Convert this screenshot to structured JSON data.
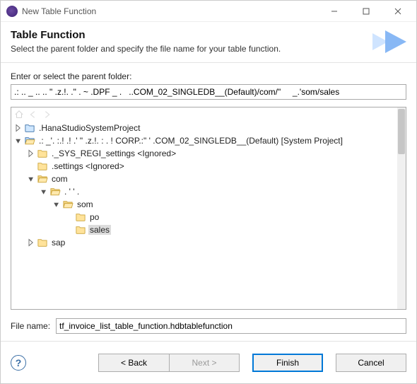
{
  "window": {
    "title": "New Table Function"
  },
  "banner": {
    "heading": "Table Function",
    "subheading": "Select the parent folder and specify the file name for your table function."
  },
  "parent_folder": {
    "label": "Enter or select the parent folder:",
    "value": ".: .. _ .. .. \" .z.!. .\" . ~ .DPF _ .   ..COM_02_SINGLEDB__(Default)/com/\"     _.'som/sales"
  },
  "tree": {
    "items": [
      {
        "level": 0,
        "expander": "closed",
        "icon": "project-closed-icon",
        "label": ".HanaStudioSystemProject",
        "selected": false
      },
      {
        "level": 0,
        "expander": "open",
        "icon": "project-open-icon",
        "label": ".: _'. :.! .! .' \" .z.!. : . ! CORP.:\"  ' .COM_02_SINGLEDB__(Default) [System Project]",
        "selected": false
      },
      {
        "level": 1,
        "expander": "closed",
        "icon": "folder-icon",
        "label": "._SYS_REGI_settings <Ignored>",
        "selected": false
      },
      {
        "level": 1,
        "expander": "none",
        "icon": "folder-icon",
        "label": ".settings <Ignored>",
        "selected": false
      },
      {
        "level": 1,
        "expander": "open",
        "icon": "folder-open-icon",
        "label": "com",
        "selected": false
      },
      {
        "level": 2,
        "expander": "open",
        "icon": "folder-open-icon",
        "label": ". '   '  .",
        "selected": false
      },
      {
        "level": 3,
        "expander": "open",
        "icon": "folder-open-icon",
        "label": "som",
        "selected": false
      },
      {
        "level": 4,
        "expander": "none",
        "icon": "folder-icon",
        "label": "po",
        "selected": false
      },
      {
        "level": 4,
        "expander": "none",
        "icon": "folder-icon",
        "label": "sales",
        "selected": true
      },
      {
        "level": 1,
        "expander": "closed",
        "icon": "folder-icon",
        "label": "sap",
        "selected": false
      }
    ]
  },
  "file_name": {
    "label": "File name:",
    "value": "tf_invoice_list_table_function.hdbtablefunction"
  },
  "buttons": {
    "back": "< Back",
    "next": "Next >",
    "finish": "Finish",
    "cancel": "Cancel"
  },
  "colors": {
    "accent": "#0078d7"
  }
}
